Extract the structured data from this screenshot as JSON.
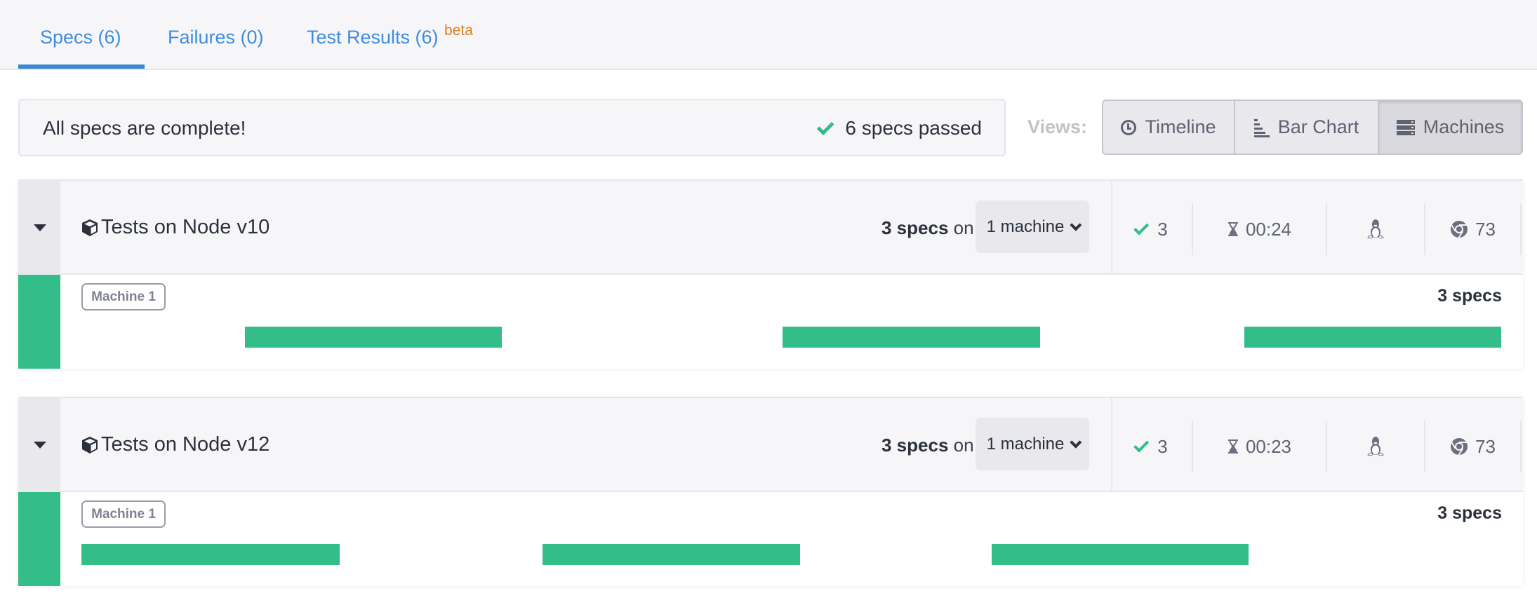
{
  "tabs": [
    {
      "label": "Specs (6)",
      "active": true
    },
    {
      "label": "Failures (0)",
      "active": false
    },
    {
      "label": "Test Results (6)",
      "badge": "beta",
      "active": false
    }
  ],
  "status": {
    "message": "All specs are complete!",
    "passed": "6 specs passed",
    "passed_icon": "check-icon"
  },
  "views": {
    "label": "Views:",
    "options": [
      {
        "label": "Timeline",
        "icon": "clock-icon",
        "active": false
      },
      {
        "label": "Bar Chart",
        "icon": "bar-chart-icon",
        "active": false
      },
      {
        "label": "Machines",
        "icon": "server-icon",
        "active": true
      }
    ]
  },
  "colors": {
    "accent": "#3a87d4",
    "passed": "#33bd88",
    "beta": "#d9801f"
  },
  "groups": [
    {
      "title": "Tests on Node v10",
      "spec_count": "3 specs",
      "on_label": "on",
      "machines_label": "1 machine",
      "passed": "3",
      "duration": "00:24",
      "os_icon": "linux-icon",
      "browser_icon": "chrome-icon",
      "browser_version": "73",
      "machines": [
        {
          "label": "Machine 1",
          "count": "3 specs",
          "specs": [
            {
              "start": 0.115,
              "end": 0.296
            },
            {
              "start": 0.494,
              "end": 0.675
            },
            {
              "start": 0.819,
              "end": 1.0
            }
          ]
        }
      ]
    },
    {
      "title": "Tests on Node v12",
      "spec_count": "3 specs",
      "on_label": "on",
      "machines_label": "1 machine",
      "passed": "3",
      "duration": "00:23",
      "os_icon": "linux-icon",
      "browser_icon": "chrome-icon",
      "browser_version": "73",
      "machines": [
        {
          "label": "Machine 1",
          "count": "3 specs",
          "specs": [
            {
              "start": 0.0,
              "end": 0.182
            },
            {
              "start": 0.325,
              "end": 0.506
            },
            {
              "start": 0.641,
              "end": 0.822
            }
          ]
        }
      ]
    }
  ]
}
